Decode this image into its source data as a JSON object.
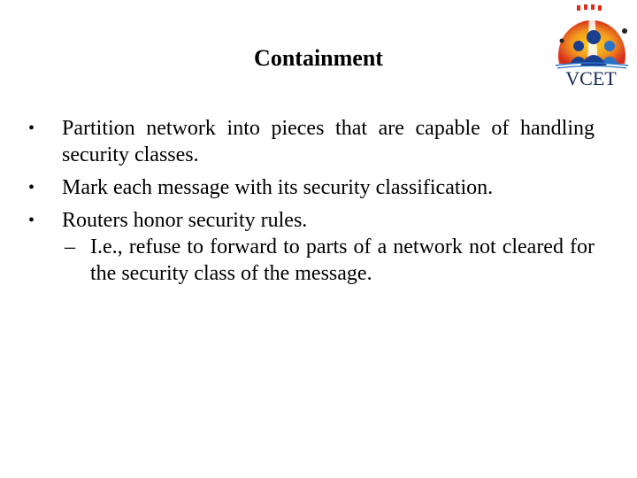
{
  "slide": {
    "title": "Containment",
    "logo": {
      "text": "VCET",
      "icon": "vcet-logo-icon",
      "colors": {
        "sun_red": "#d8301c",
        "sun_orange": "#f29a1f",
        "sun_yellow": "#ffd21a",
        "people_blue": "#1b3f8f",
        "people_light": "#2a73c9",
        "text": "#1a2a5a"
      }
    },
    "bullets": [
      {
        "marker": "•",
        "text": "Partition network into pieces that are capable of handling security classes."
      },
      {
        "marker": "•",
        "text": "Mark each message with its security classification."
      },
      {
        "marker": "•",
        "text": "Routers honor security rules.",
        "sub": [
          {
            "marker": "–",
            "text": "I.e., refuse to forward to parts of a network not cleared for the security class of the message."
          }
        ]
      }
    ]
  }
}
